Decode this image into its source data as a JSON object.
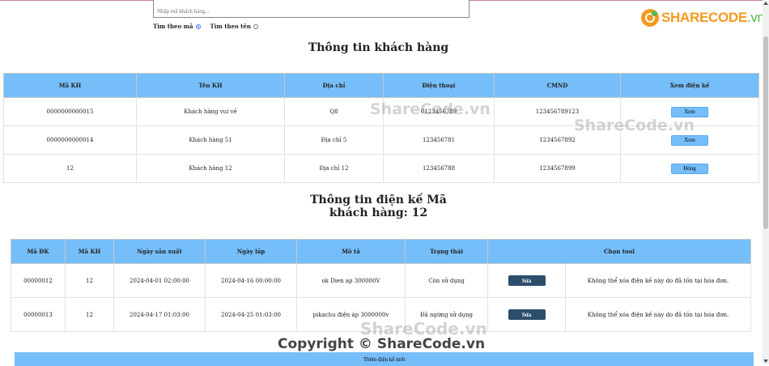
{
  "search": {
    "placeholder": "Nhập mã khách hàng..."
  },
  "filter": {
    "by_code_label": "Tìm theo mã",
    "by_name_label": "Tìm theo tên",
    "selected": "by_code"
  },
  "logo": {
    "main": "SHARECODE",
    "suffix": ".vn"
  },
  "customer_section": {
    "title": "Thông tin khách hàng",
    "headers": [
      "Mã KH",
      "Tên KH",
      "Địa chỉ",
      "Điện thoại",
      "CMND",
      "Xem điện kế"
    ],
    "rows": [
      {
        "ma_kh": "0000000000015",
        "ten_kh": "Khách hàng vui vẻ",
        "dia_chi": "Q8",
        "dien_thoai": "0123456789",
        "cmnd": "123456789123",
        "button": "Xem"
      },
      {
        "ma_kh": "0000000000014",
        "ten_kh": "Khách hàng 51",
        "dia_chi": "Địa chỉ 5",
        "dien_thoai": "123456781",
        "cmnd": "1234567892",
        "button": "Xem"
      },
      {
        "ma_kh": "12",
        "ten_kh": "Khách hàng 12",
        "dia_chi": "Địa chỉ 12",
        "dien_thoai": "123456788",
        "cmnd": "1234567899",
        "button": "Đóng"
      }
    ]
  },
  "meter_section": {
    "title_line1": "Thông tin điện kế Mã",
    "title_line2": "khách hàng: 12",
    "headers": [
      "Mã ĐK",
      "Mã KH",
      "Ngày sản xuất",
      "Ngày lắp",
      "Mô tả",
      "Trạng thái",
      "Chọn tool"
    ],
    "rows": [
      {
        "ma_dk": "00000012",
        "ma_kh": "12",
        "ngay_sx": "2024-04-01 02:00:00",
        "ngay_lap": "2024-04-16 00:00:00",
        "mo_ta": "ok Dien ap 300000V",
        "trang_thai": "Còn sử dụng",
        "button": "Sửa",
        "note": "Không thể xóa điện kế này do đã tồn tại hóa đơn."
      },
      {
        "ma_dk": "00000013",
        "ma_kh": "12",
        "ngay_sx": "2024-04-17 01:03:00",
        "ngay_lap": "2024-04-25 01:03:00",
        "mo_ta": "pikachu điện áp 3000000v",
        "trang_thai": "Đã ngừng sử dụng",
        "button": "Sửa",
        "note": "Không thể xóa điện kế này do đã tồn tại hóa đơn."
      }
    ],
    "add_button": "Thêm điện kế mới"
  },
  "watermarks": {
    "text": "ShareCode.vn",
    "copyright": "Copyright © ShareCode.vn"
  }
}
